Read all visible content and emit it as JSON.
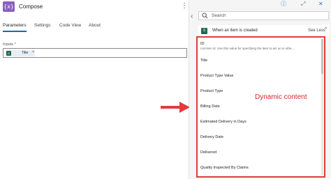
{
  "left_pane": {
    "title": "Compose",
    "app_icon_glyph": "{x}",
    "more_icon": "⋮",
    "tabs": [
      {
        "label": "Parameters",
        "active": true
      },
      {
        "label": "Settings",
        "active": false
      },
      {
        "label": "Code View",
        "active": false
      },
      {
        "label": "About",
        "active": false
      }
    ],
    "inputs_label": "Inputs *",
    "token": {
      "icon_glyph": "S",
      "text": "Title",
      "remove": "×"
    }
  },
  "right_pane": {
    "controls": {
      "collapse": "‹",
      "info": "ⓘ",
      "expand": "⤢",
      "close": "✕"
    },
    "search": {
      "placeholder": "Search"
    },
    "header": {
      "icon_glyph": "S",
      "title": "When an item is created",
      "link": "See Less",
      "chevron": "^"
    },
    "items": [
      {
        "title": "ID",
        "description": "List item id. Use this value for specifying the item to act on in othe..."
      },
      {
        "title": "Title"
      },
      {
        "title": "Product Type Value"
      },
      {
        "title": "Product Type"
      },
      {
        "title": "Billing Date"
      },
      {
        "title": "Estimated Delivery in Days"
      },
      {
        "title": "Delivery Date"
      },
      {
        "title": "Delivered"
      },
      {
        "title": "Quality Inspected By Claims"
      }
    ],
    "annotation": "Dynamic content"
  },
  "colors": {
    "accent": "#0f6cbd",
    "annotation_red": "#e03b3b",
    "app_icon": "#8a5fbf",
    "sharepoint_green": "#1e6b52"
  }
}
